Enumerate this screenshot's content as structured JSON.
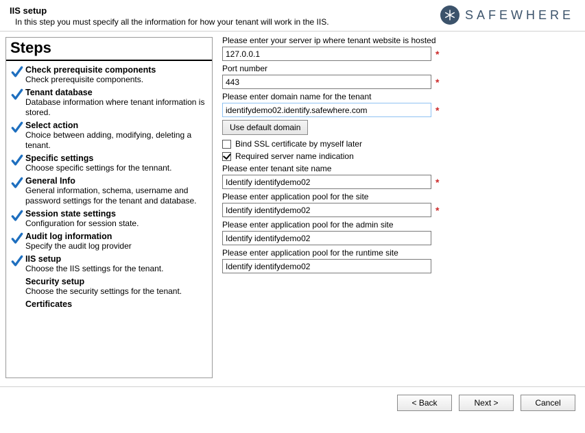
{
  "header": {
    "title": "IIS setup",
    "subtitle": "In this step you must specify all the information for how your tenant will work in the IIS."
  },
  "brand": {
    "name": "SAFEWHERE"
  },
  "steps_title": "Steps",
  "steps": [
    {
      "name": "Check prerequisite components",
      "desc": "Check prerequisite components.",
      "done": true
    },
    {
      "name": "Tenant database",
      "desc": "Database information where tenant information is stored.",
      "done": true
    },
    {
      "name": "Select action",
      "desc": "Choice between adding, modifying, deleting a tenant.",
      "done": true
    },
    {
      "name": "Specific settings",
      "desc": "Choose specific settings for the tennant.",
      "done": true
    },
    {
      "name": "General Info",
      "desc": "General information, schema, username and password settings for the tenant and database.",
      "done": true
    },
    {
      "name": "Session state settings",
      "desc": "Configuration for session state.",
      "done": true
    },
    {
      "name": "Audit log information",
      "desc": "Specify the audit log provider",
      "done": true
    },
    {
      "name": "IIS setup",
      "desc": "Choose the IIS settings for the tenant.",
      "done": true
    },
    {
      "name": "Security setup",
      "desc": "Choose the security settings for the tenant.",
      "done": false
    },
    {
      "name": "Certificates",
      "desc": "",
      "done": false
    }
  ],
  "form": {
    "server_ip": {
      "label": "Please enter your server ip where tenant website is hosted",
      "value": "127.0.0.1",
      "required": true
    },
    "port": {
      "label": "Port number",
      "value": "443",
      "required": true
    },
    "domain": {
      "label": "Please enter domain name for the tenant",
      "value": "identifydemo02.identify.safewhere.com",
      "required": true
    },
    "use_default_domain_btn": "Use default domain",
    "bind_ssl": {
      "label": "Bind SSL certificate by myself later",
      "checked": false
    },
    "sni": {
      "label": "Required server name indication",
      "checked": true
    },
    "site_name": {
      "label": "Please enter tenant site name",
      "value": "Identify identifydemo02",
      "required": true
    },
    "app_pool": {
      "label": "Please enter application pool for the site",
      "value": "Identify identifydemo02",
      "required": true
    },
    "admin_pool": {
      "label": "Please enter application pool for the admin site",
      "value": "Identify identifydemo02",
      "required": false
    },
    "runtime_pool": {
      "label": "Please enter application pool for the runtime site",
      "value": "Identify identifydemo02",
      "required": false
    }
  },
  "footer": {
    "back": "< Back",
    "next": "Next >",
    "cancel": "Cancel"
  }
}
